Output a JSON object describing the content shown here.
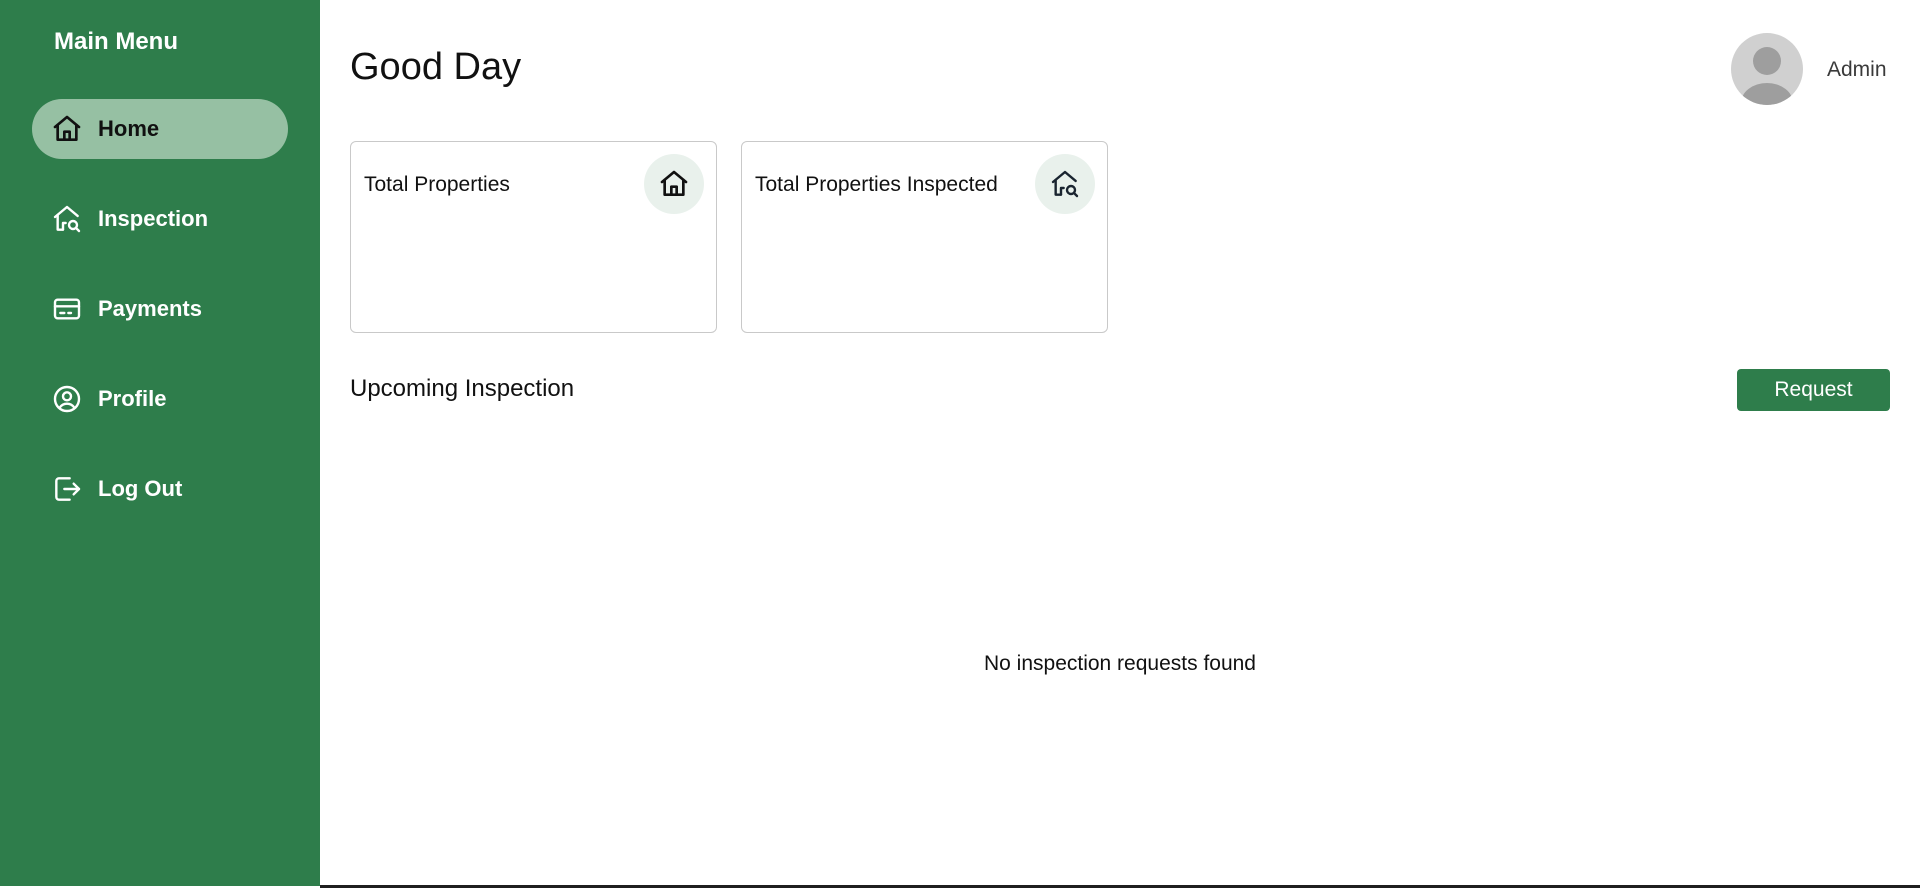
{
  "sidebar": {
    "title": "Main Menu",
    "items": [
      {
        "label": "Home",
        "icon": "home-icon",
        "active": true
      },
      {
        "label": "Inspection",
        "icon": "home-search-icon",
        "active": false
      },
      {
        "label": "Payments",
        "icon": "credit-card-icon",
        "active": false
      },
      {
        "label": "Profile",
        "icon": "user-circle-icon",
        "active": false
      },
      {
        "label": "Log Out",
        "icon": "logout-icon",
        "active": false
      }
    ]
  },
  "header": {
    "title": "Good Day",
    "user_name": "Admin",
    "avatar_icon": "user-avatar-icon"
  },
  "cards": [
    {
      "label": "Total Properties",
      "icon": "home-icon"
    },
    {
      "label": "Total Properties Inspected",
      "icon": "home-search-icon"
    }
  ],
  "upcoming": {
    "title": "Upcoming Inspection",
    "request_label": "Request",
    "empty_message": "No inspection requests found"
  },
  "colors": {
    "sidebar_bg": "#2e7d4b",
    "active_item_bg": "#96c0a3",
    "button_bg": "#2e7d4b",
    "card_icon_bg": "#e9f1ec"
  }
}
